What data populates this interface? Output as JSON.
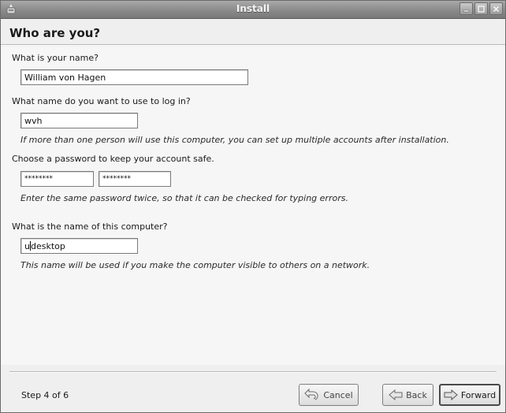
{
  "window": {
    "title": "Install"
  },
  "page": {
    "title": "Who are you?"
  },
  "form": {
    "name_label": "What is your name?",
    "name_value": "William von Hagen",
    "login_label": "What name do you want to use to log in?",
    "login_value": "wvh",
    "login_hint": "If more than one person will use this computer, you can set up multiple accounts after installation.",
    "password_label": "Choose a password to keep your account safe.",
    "password_value": "********",
    "password_confirm_value": "********",
    "password_hint": "Enter the same password twice, so that it can be checked for typing errors.",
    "computer_label": "What is the name of this computer?",
    "computer_value_before_caret": "u",
    "computer_value_after_caret": "desktop",
    "computer_hint": "This name will be used if you make the computer visible to others on a network."
  },
  "footer": {
    "step": "Step 4 of 6",
    "cancel_label": "Cancel",
    "back_label": "Back",
    "forward_label": "Forward"
  },
  "icons": {
    "app": "installer-icon",
    "cancel": "undo-arrow-icon",
    "back": "left-arrow-icon",
    "forward": "right-arrow-icon"
  }
}
